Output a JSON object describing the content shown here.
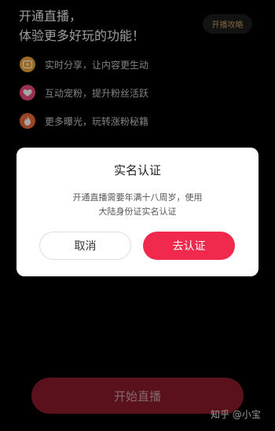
{
  "header": {
    "title_line1": "开通直播，",
    "title_line2": "体验更多好玩的功能！",
    "guide_button": "开播攻略"
  },
  "features": [
    {
      "icon": "share-icon",
      "label": "实时分享，让内容更生动",
      "color": "#f0a53a"
    },
    {
      "icon": "heart-icon",
      "label": "互动宠粉，提升粉丝活跃",
      "color": "#f04b7a"
    },
    {
      "icon": "fire-icon",
      "label": "更多曝光，玩转涨粉秘籍",
      "color": "#ef6a3a"
    }
  ],
  "dialog": {
    "title": "实名认证",
    "message_line1": "开通直播需要年满十八周岁，使用",
    "message_line2": "大陆身份证实名认证",
    "cancel_label": "取消",
    "confirm_label": "去认证"
  },
  "start_button": "开始直播",
  "watermark": "知乎 @小宝"
}
